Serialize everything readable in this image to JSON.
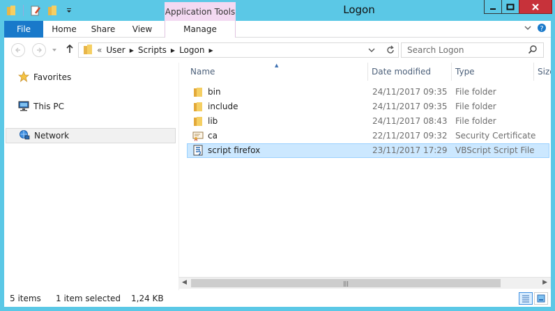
{
  "window": {
    "title": "Logon",
    "contextual_tab": "Application Tools"
  },
  "ribbon": {
    "tabs": [
      "File",
      "Home",
      "Share",
      "View",
      "Manage"
    ]
  },
  "address": {
    "overflow": "«",
    "crumbs": [
      "User",
      "Scripts",
      "Logon"
    ],
    "search_placeholder": "Search Logon"
  },
  "navpane": {
    "items": [
      "Favorites",
      "This PC",
      "Network"
    ]
  },
  "columns": [
    "Name",
    "Date modified",
    "Type",
    "Size"
  ],
  "files": [
    {
      "name": "bin",
      "date": "24/11/2017 09:35",
      "type": "File folder",
      "icon": "folder-icon"
    },
    {
      "name": "include",
      "date": "24/11/2017 09:35",
      "type": "File folder",
      "icon": "folder-icon"
    },
    {
      "name": "lib",
      "date": "24/11/2017 08:43",
      "type": "File folder",
      "icon": "folder-icon"
    },
    {
      "name": "ca",
      "date": "22/11/2017 09:32",
      "type": "Security Certificate",
      "icon": "certificate-icon"
    },
    {
      "name": "script firefox",
      "date": "23/11/2017 17:29",
      "type": "VBScript Script File",
      "icon": "vbscript-icon"
    }
  ],
  "status": {
    "count": "5 items",
    "selection": "1 item selected",
    "size": "1,24 KB"
  },
  "colors": {
    "frame": "#5bc8e6",
    "file_tab": "#1979ca",
    "contextual": "#f3d9f2",
    "selection": "#cce8ff",
    "close": "#c7323a"
  }
}
